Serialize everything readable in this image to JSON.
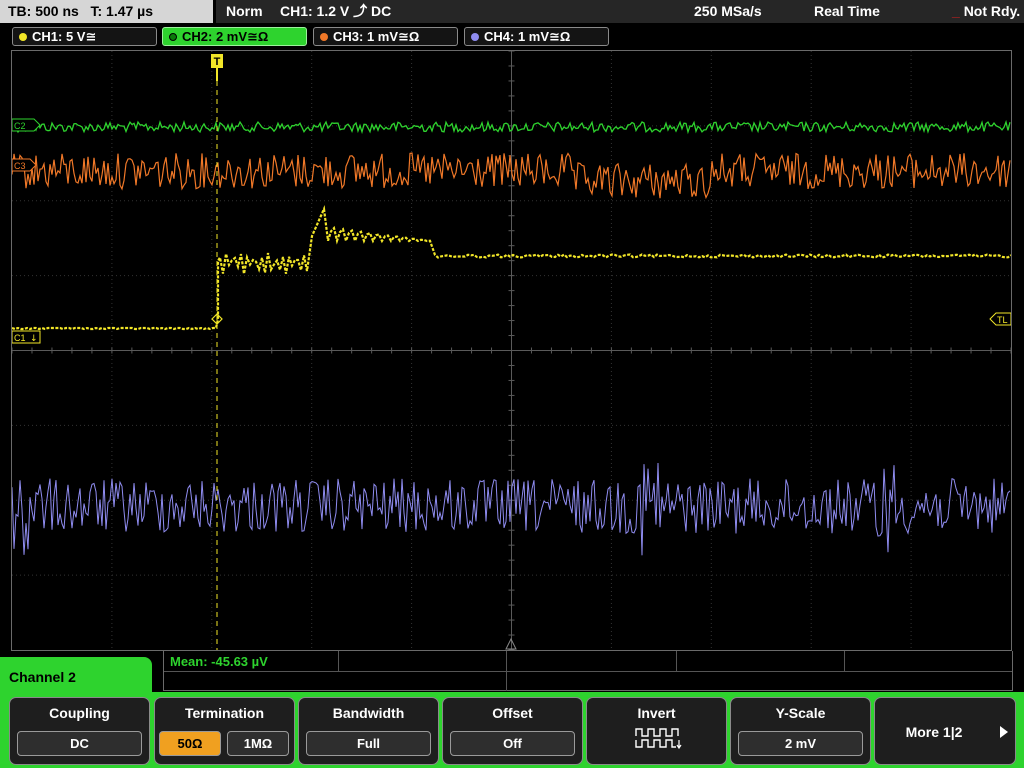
{
  "status": {
    "timebase": "TB: 500 ns",
    "trigger_time": "T: 1.47 µs",
    "mode": "Norm",
    "trigger": "CH1: 1.2 V ⤴ DC",
    "sample_rate": "250 MSa/s",
    "acquisition": "Real Time",
    "state": "Not Rdy."
  },
  "channels": [
    {
      "label": "CH1: 5 V≅",
      "color": "#f2e628"
    },
    {
      "label": "CH2: 2 mV≅Ω",
      "color": "#2ed32e",
      "active": true
    },
    {
      "label": "CH3: 1 mV≅Ω",
      "color": "#f07828"
    },
    {
      "label": "CH4: 1 mV≅Ω",
      "color": "#8f8cf0"
    }
  ],
  "markers": {
    "c2": "C2",
    "c3": "C3",
    "c1": "C1",
    "trigger_level": "TL",
    "trigger_pos": "T"
  },
  "measurement": {
    "text": "Mean: -45.63 µV"
  },
  "menu": {
    "title": "Channel 2",
    "coupling": {
      "label": "Coupling",
      "value": "DC"
    },
    "termination": {
      "label": "Termination",
      "opt1": "50Ω",
      "opt2": "1MΩ",
      "selected": "50Ω"
    },
    "bandwidth": {
      "label": "Bandwidth",
      "value": "Full"
    },
    "offset": {
      "label": "Offset",
      "value": "Off"
    },
    "invert": {
      "label": "Invert"
    },
    "yscale": {
      "label": "Y-Scale",
      "value": "2 mV"
    },
    "more": {
      "label": "More 1|2"
    }
  }
}
